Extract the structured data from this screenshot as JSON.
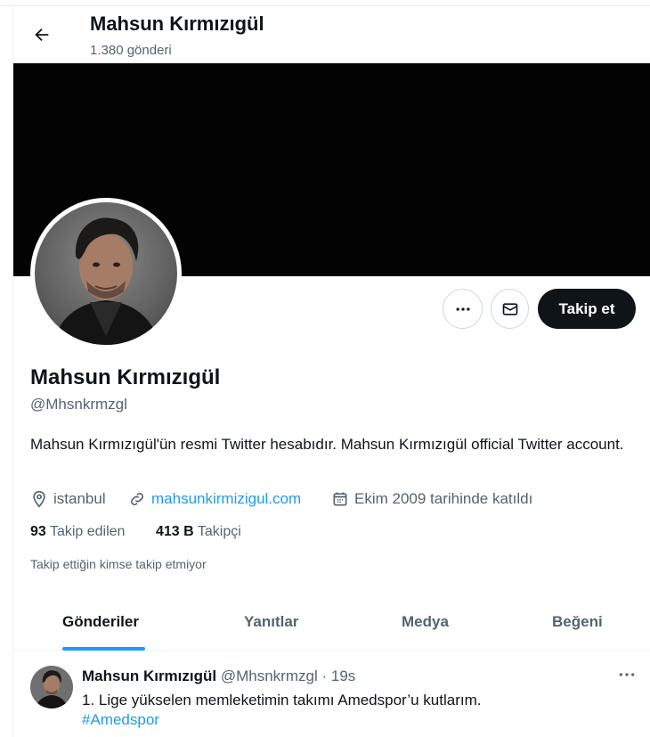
{
  "header": {
    "name": "Mahsun Kırmızıgül",
    "post_count": "1.380 gönderi",
    "back_icon": "arrow-left-icon"
  },
  "banner": {
    "color": "#030303"
  },
  "actions": {
    "more_icon": "more-horizontal-icon",
    "message_icon": "envelope-icon",
    "follow_label": "Takip et"
  },
  "profile": {
    "name": "Mahsun Kırmızıgül",
    "handle": "@Mhsnkrmzgl",
    "bio": "Mahsun Kırmızıgül'ün resmi Twitter hesabıdır. Mahsun Kırmızıgül official Twitter account.",
    "location": "istanbul",
    "location_icon": "location-pin-icon",
    "website": "mahsunkirmizigul.com",
    "website_icon": "link-icon",
    "joined": "Ekim 2009 tarihinde katıldı",
    "joined_icon": "calendar-icon",
    "following_count": "93",
    "following_label": "Takip edilen",
    "followers_count": "413 B",
    "followers_label": "Takipçi",
    "mutual_note": "Takip ettiğin kimse takip etmiyor"
  },
  "tabs": [
    {
      "label": "Gönderiler",
      "active": true
    },
    {
      "label": "Yanıtlar",
      "active": false
    },
    {
      "label": "Medya",
      "active": false
    },
    {
      "label": "Beğeni",
      "active": false
    }
  ],
  "tweet": {
    "name": "Mahsun Kırmızıgül",
    "handle": "@Mhsnkrmzgl",
    "separator": "·",
    "time": "19s",
    "text": "1. Lige yükselen memleketimin takımı Amedspor’u kutlarım.",
    "hashtag": "#Amedspor",
    "more_icon": "more-horizontal-icon"
  },
  "colors": {
    "accent": "#1d9bf0",
    "text_primary": "#0f1419",
    "text_secondary": "#536471",
    "follow_button_bg": "#0f1419"
  }
}
